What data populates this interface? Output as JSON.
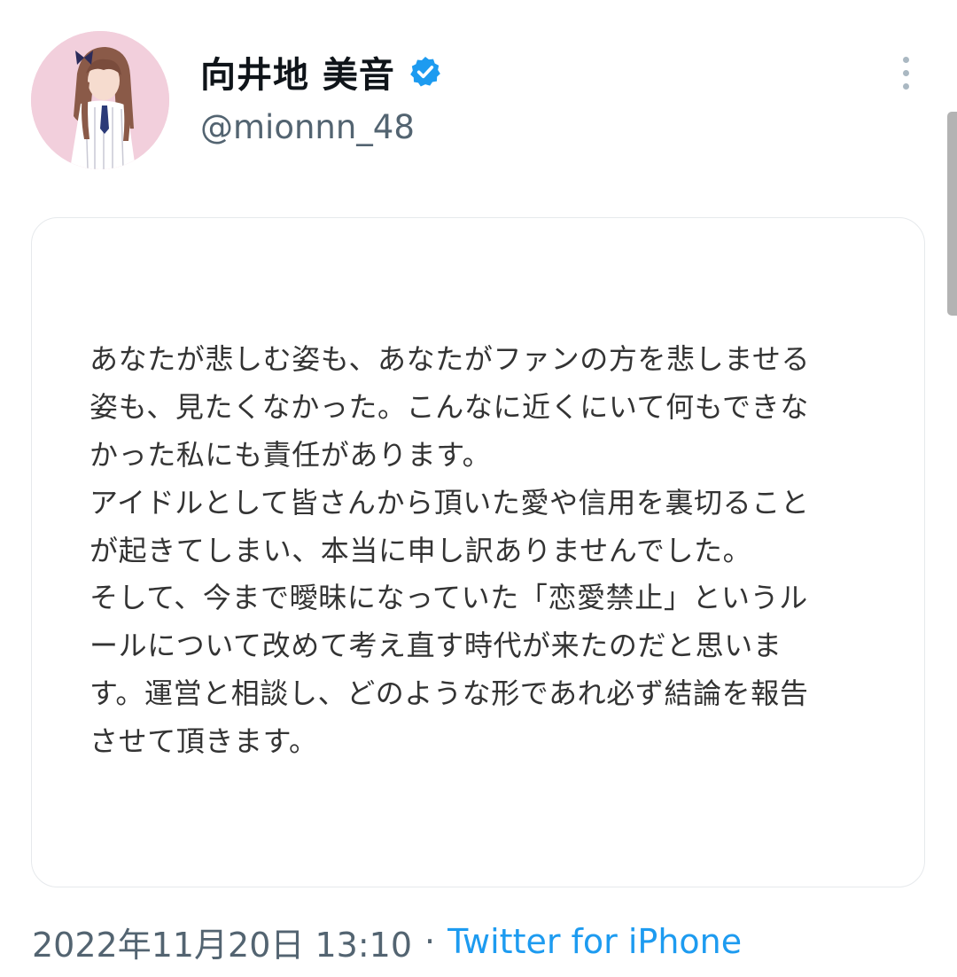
{
  "author": {
    "display_name": "向井地 美音",
    "handle": "@mionnn_48",
    "avatar_icon": "profile-photo",
    "verified_icon": "verified-badge-icon"
  },
  "colors": {
    "name": "#0f1419",
    "secondary_text": "#536471",
    "link": "#1d9bf0",
    "verified": "#1d9bf0",
    "card_border": "#e6e9ec",
    "statement_text": "#333333"
  },
  "statement": {
    "lines": [
      "あなたが悲しむ姿も、あなたがファンの方を悲しませる",
      "姿も、見たくなかった。こんなに近くにいて何もできな",
      "かった私にも責任があります。",
      "アイドルとして皆さんから頂いた愛や信用を裏切ること",
      "が起きてしまい、本当に申し訳ありませんでした。",
      "そして、今まで曖昧になっていた「恋愛禁止」というル",
      "ールについて改めて考え直す時代が来たのだと思いま",
      "す。運営と相談し、どのような形であれ必ず結論を報告",
      "させて頂きます。"
    ]
  },
  "meta": {
    "timestamp": "2022年11月20日 13:10",
    "separator": "·",
    "source": "Twitter for iPhone"
  },
  "menu": {
    "more_icon": "more-vertical-icon"
  }
}
